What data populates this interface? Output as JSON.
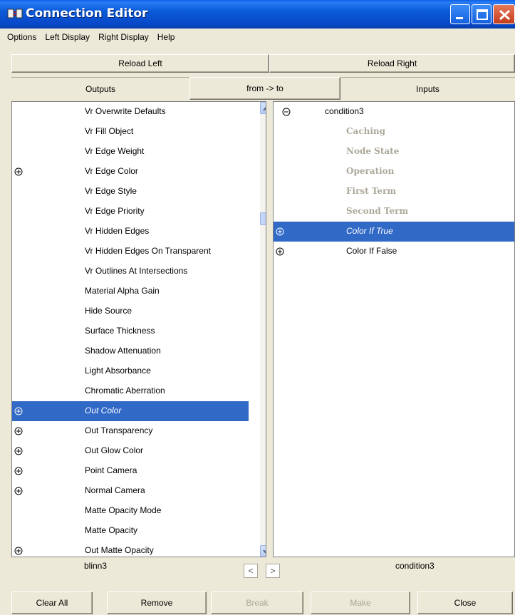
{
  "window": {
    "title": "Connection Editor"
  },
  "menu": [
    "Options",
    "Left Display",
    "Right Display",
    "Help"
  ],
  "reload": {
    "left": "Reload Left",
    "right": "Reload Right"
  },
  "headers": {
    "outputs": "Outputs",
    "direction": "from -> to",
    "inputs": "Inputs"
  },
  "left_list": [
    {
      "label": "Vr Overwrite Defaults",
      "expandable": false,
      "selected": false
    },
    {
      "label": "Vr Fill Object",
      "expandable": false,
      "selected": false
    },
    {
      "label": "Vr Edge Weight",
      "expandable": false,
      "selected": false
    },
    {
      "label": "Vr Edge Color",
      "expandable": true,
      "selected": false
    },
    {
      "label": "Vr Edge Style",
      "expandable": false,
      "selected": false
    },
    {
      "label": "Vr Edge Priority",
      "expandable": false,
      "selected": false
    },
    {
      "label": "Vr Hidden Edges",
      "expandable": false,
      "selected": false
    },
    {
      "label": "Vr Hidden Edges On Transparent",
      "expandable": false,
      "selected": false
    },
    {
      "label": "Vr Outlines At Intersections",
      "expandable": false,
      "selected": false
    },
    {
      "label": "Material Alpha Gain",
      "expandable": false,
      "selected": false
    },
    {
      "label": "Hide Source",
      "expandable": false,
      "selected": false
    },
    {
      "label": "Surface Thickness",
      "expandable": false,
      "selected": false
    },
    {
      "label": "Shadow Attenuation",
      "expandable": false,
      "selected": false
    },
    {
      "label": "Light Absorbance",
      "expandable": false,
      "selected": false
    },
    {
      "label": "Chromatic Aberration",
      "expandable": false,
      "selected": false
    },
    {
      "label": "Out Color",
      "expandable": true,
      "selected": true
    },
    {
      "label": "Out Transparency",
      "expandable": true,
      "selected": false
    },
    {
      "label": "Out Glow Color",
      "expandable": true,
      "selected": false
    },
    {
      "label": "Point Camera",
      "expandable": true,
      "selected": false
    },
    {
      "label": "Normal Camera",
      "expandable": true,
      "selected": false
    },
    {
      "label": "Matte Opacity Mode",
      "expandable": false,
      "selected": false
    },
    {
      "label": "Matte Opacity",
      "expandable": false,
      "selected": false
    },
    {
      "label": "Out Matte Opacity",
      "expandable": true,
      "selected": false
    }
  ],
  "right_list": [
    {
      "label": "condition3",
      "kind": "collapse",
      "dim": false,
      "selected": false
    },
    {
      "label": "Caching",
      "kind": "none",
      "dim": true,
      "selected": false
    },
    {
      "label": "Node State",
      "kind": "none",
      "dim": true,
      "selected": false
    },
    {
      "label": "Operation",
      "kind": "none",
      "dim": true,
      "selected": false
    },
    {
      "label": "First Term",
      "kind": "none",
      "dim": true,
      "selected": false
    },
    {
      "label": "Second Term",
      "kind": "none",
      "dim": true,
      "selected": false
    },
    {
      "label": "Color If True",
      "kind": "expand",
      "dim": false,
      "selected": true
    },
    {
      "label": "Color If False",
      "kind": "expand",
      "dim": false,
      "selected": false
    }
  ],
  "footer": {
    "left_node": "blinn3",
    "right_node": "condition3",
    "scroll_left": "<",
    "scroll_right": ">"
  },
  "buttons": {
    "clear_all": "Clear All",
    "remove": "Remove",
    "break": "Break",
    "make": "Make",
    "close": "Close"
  },
  "colors": {
    "selection": "#3169c6",
    "titlebar": "#0a5ad8",
    "dim_text": "#aca899"
  }
}
